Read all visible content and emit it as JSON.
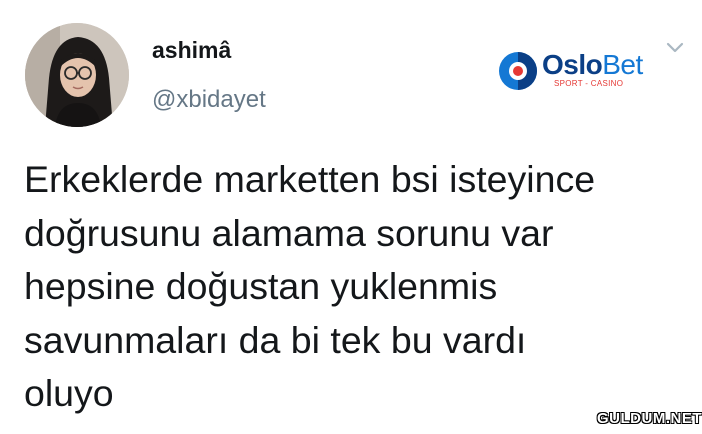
{
  "tweet": {
    "display_name": "ashimâ",
    "handle": "@xbidayet",
    "text_lines": [
      "Erkeklerde marketten bsi isteyince",
      "doğrusunu alamama sorunu var",
      "hepsine doğustan yuklenmis",
      "savunmaları da bi tek bu vardı",
      "oluyo"
    ]
  },
  "sponsor": {
    "name_part1": "Oslo",
    "name_part2": "Bet",
    "tagline": "SPORT - CASINO"
  },
  "watermark": "GULDUM.NET",
  "icons": {
    "menu": "chevron-down-icon",
    "brand": "oslobet-logo-icon"
  },
  "colors": {
    "text": "#14171a",
    "secondary": "#657786",
    "brand_dark": "#0b3f86",
    "brand_light": "#1478d4",
    "brand_accent": "#e53935"
  }
}
